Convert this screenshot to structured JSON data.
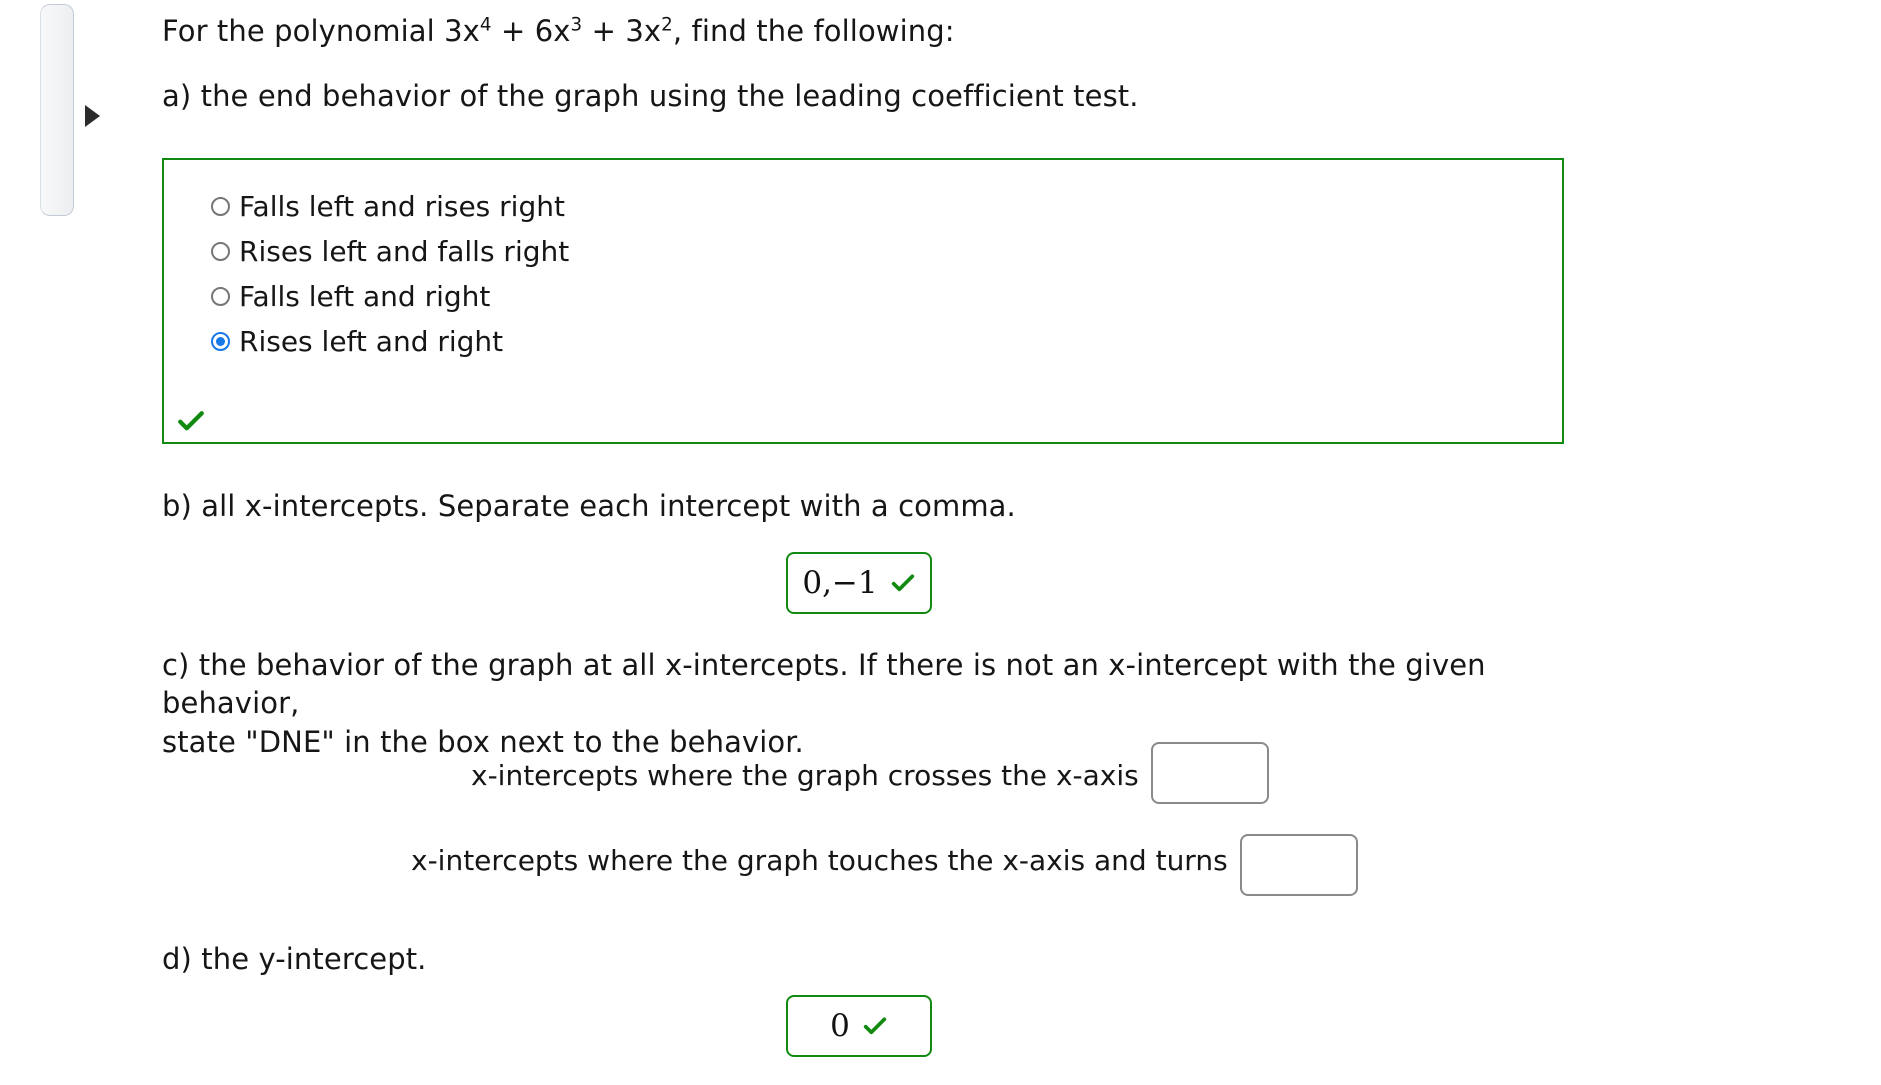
{
  "panel": {
    "toggle_icon": "triangle-right-icon"
  },
  "question": {
    "stem_prefix": "For the polynomial ",
    "polynomial": {
      "t1_coeff": "3x",
      "t1_exp": "4",
      "op1": " + ",
      "t2_coeff": "6x",
      "t2_exp": "3",
      "op2": " + ",
      "t3_coeff": "3x",
      "t3_exp": "2"
    },
    "stem_suffix": ", find the following:",
    "part_a": "a) the end behavior of the graph using the leading coefficient test.",
    "part_b": "b) all x-intercepts. Separate each intercept with a comma.",
    "part_c_line1": "c) the behavior of the graph at all x-intercepts. If there is not an x-intercept with the given behavior,",
    "part_c_line2": "state \"DNE\" in the box next to the behavior.",
    "part_d": "d) the y-intercept."
  },
  "choices": {
    "items": [
      {
        "label": "Falls left and rises right",
        "selected": false
      },
      {
        "label": "Rises left and falls right",
        "selected": false
      },
      {
        "label": "Falls left and right",
        "selected": false
      },
      {
        "label": "Rises left and right",
        "selected": true
      }
    ],
    "group_status_icon": "green-check-icon",
    "correct_color": "#108a10",
    "selected_color": "#1778e8",
    "unselected_color": "#767676"
  },
  "answers": {
    "part_b": {
      "value": "0,−1",
      "status_icon": "green-check-icon",
      "placeholder": "",
      "graded": true
    },
    "part_c_cross": {
      "label": "x-intercepts where the graph crosses the x-axis",
      "value": "",
      "placeholder": "",
      "graded": false
    },
    "part_c_touch": {
      "label": "x-intercepts where the graph touches the x-axis and turns",
      "value": "",
      "placeholder": "",
      "graded": false
    },
    "part_d": {
      "value": "0",
      "status_icon": "green-check-icon",
      "placeholder": "",
      "graded": true
    }
  },
  "colors": {
    "correct_green": "#108a10",
    "radio_blue": "#1778e8",
    "blank_border_gray": "#8a8a8a",
    "text_black": "#161616"
  }
}
